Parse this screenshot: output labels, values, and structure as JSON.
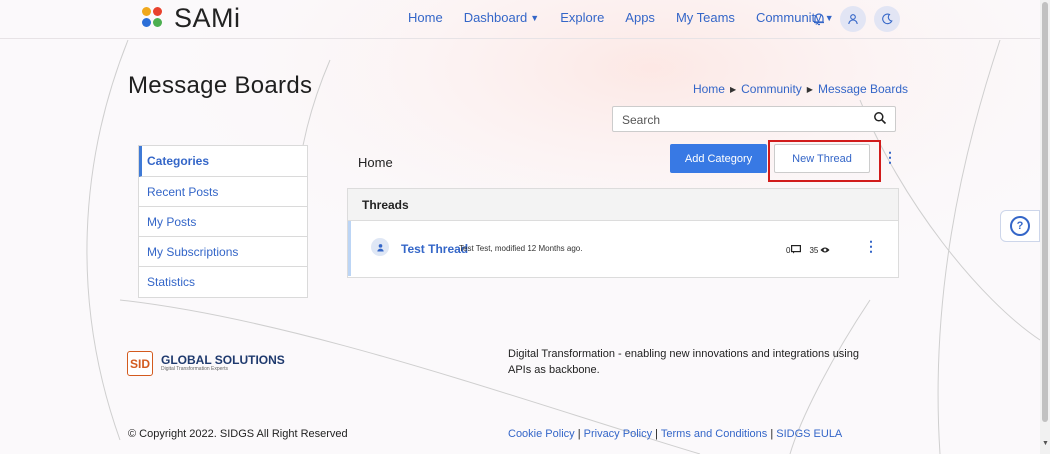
{
  "app": {
    "name": "SAMi"
  },
  "nav": {
    "items": [
      {
        "label": "Home",
        "dropdown": false
      },
      {
        "label": "Dashboard",
        "dropdown": true
      },
      {
        "label": "Explore",
        "dropdown": false
      },
      {
        "label": "Apps",
        "dropdown": false
      },
      {
        "label": "My Teams",
        "dropdown": false
      },
      {
        "label": "Community",
        "dropdown": true
      }
    ],
    "icons": [
      "bell-icon",
      "user-icon",
      "moon-icon"
    ]
  },
  "page": {
    "title": "Message Boards"
  },
  "breadcrumb": [
    "Home",
    "Community",
    "Message Boards"
  ],
  "search": {
    "placeholder": "Search"
  },
  "categories": {
    "items": [
      "Categories",
      "Recent Posts",
      "My Posts",
      "My Subscriptions",
      "Statistics"
    ],
    "active": "Categories"
  },
  "content": {
    "location_label": "Home",
    "add_category_label": "Add Category",
    "new_thread_label": "New Thread"
  },
  "threads": {
    "header": "Threads",
    "rows": [
      {
        "title": "Test Thread",
        "meta": "Test Test, modified 12 Months ago.",
        "replies": "0",
        "views": "35"
      }
    ]
  },
  "footer": {
    "logo_mark": "SID",
    "logo_name": "GLOBAL SOLUTIONS",
    "logo_tagline": "Digital Transformation Experts",
    "description": "Digital Transformation - enabling new innovations and integrations using APIs as backbone.",
    "copyright": "© Copyright 2022. SIDGS All Right Reserved",
    "links": [
      "Cookie Policy",
      "Privacy Policy",
      "Terms and Conditions",
      "SIDGS EULA"
    ]
  },
  "colors": {
    "accent": "#3466c8",
    "primary_button": "#3879e4",
    "highlight_box": "#d11b1b"
  }
}
